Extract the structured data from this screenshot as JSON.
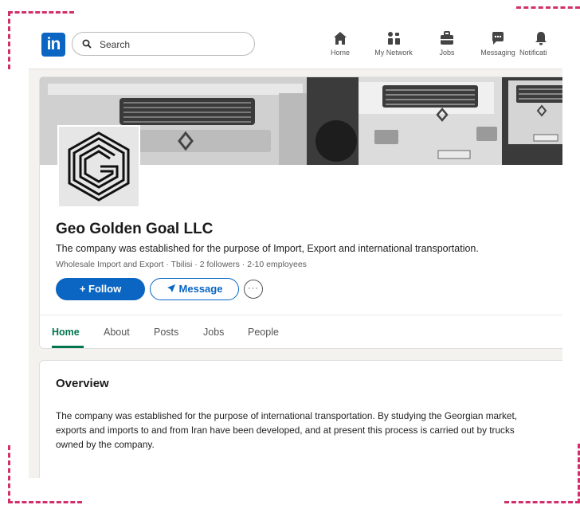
{
  "topbar": {
    "logo_text": "in",
    "search_placeholder": "Search",
    "nav": [
      {
        "label": "Home",
        "icon": "home-icon"
      },
      {
        "label": "My Network",
        "icon": "network-icon"
      },
      {
        "label": "Jobs",
        "icon": "briefcase-icon"
      },
      {
        "label": "Messaging",
        "icon": "messaging-icon"
      },
      {
        "label": "Notificati",
        "icon": "bell-icon"
      }
    ]
  },
  "company": {
    "name": "Geo Golden Goal LLC",
    "tagline": "The company was established for the purpose of Import, Export and international transportation.",
    "meta": "Wholesale Import and Export · Tbilisi · 2 followers · 2-10 employees",
    "follow_label": "+ Follow",
    "message_label": "Message",
    "more_label": "···"
  },
  "tabs": [
    {
      "label": "Home",
      "active": true
    },
    {
      "label": "About",
      "active": false
    },
    {
      "label": "Posts",
      "active": false
    },
    {
      "label": "Jobs",
      "active": false
    },
    {
      "label": "People",
      "active": false
    }
  ],
  "overview": {
    "title": "Overview",
    "body": "The company was established for the purpose of international transportation. By studying the Georgian market, exports and imports to and from Iran have been developed, and at present this process is carried out by trucks owned by the company."
  },
  "colors": {
    "brand": "#0a66c2",
    "tab_active": "#01754f",
    "frame_marks": "#d12f6a"
  }
}
